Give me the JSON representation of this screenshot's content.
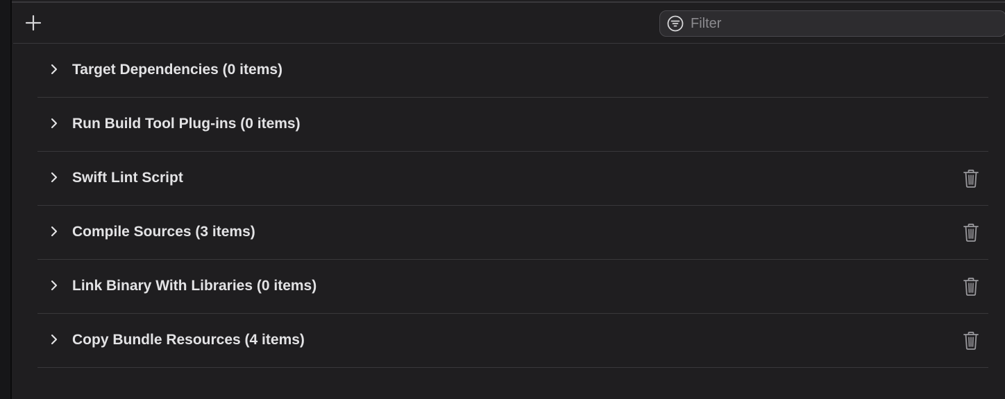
{
  "toolbar": {
    "add_icon": "plus-icon",
    "filter": {
      "icon": "filter-circle-icon",
      "placeholder": "Filter",
      "value": ""
    }
  },
  "phases": [
    {
      "title": "Target Dependencies (0 items)",
      "deletable": false
    },
    {
      "title": "Run Build Tool Plug-ins (0 items)",
      "deletable": false
    },
    {
      "title": "Swift Lint Script",
      "deletable": true
    },
    {
      "title": "Compile Sources (3 items)",
      "deletable": true
    },
    {
      "title": "Link Binary With Libraries (0 items)",
      "deletable": true
    },
    {
      "title": "Copy Bundle Resources (4 items)",
      "deletable": true
    }
  ],
  "icons": {
    "expand": "chevron-right-icon",
    "delete": "trash-icon"
  },
  "colors": {
    "background": "#1f1e20",
    "text": "#e3e3e5",
    "separator": "#39383b",
    "placeholder": "#8c8b8f"
  }
}
